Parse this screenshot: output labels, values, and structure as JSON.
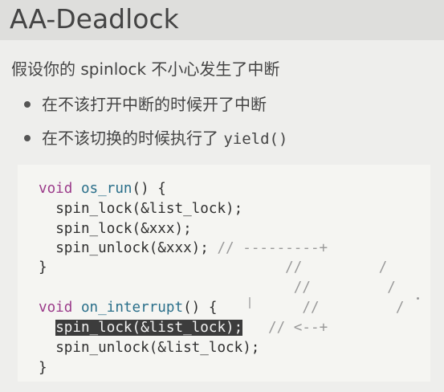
{
  "slide": {
    "title": "AA-Deadlock",
    "subtitle": "假设你的 spinlock 不小心发生了中断",
    "bullets": [
      {
        "text": "在不该打开中断的时候开了中断",
        "mono": ""
      },
      {
        "text": "在不该切换的时候执行了 ",
        "mono": "yield()"
      }
    ]
  },
  "code": {
    "lines": [
      {
        "kw": "void",
        "fn": "os_run",
        "rest": "() {"
      },
      {
        "indent": "  ",
        "text": "spin_lock(&list_lock);"
      },
      {
        "indent": "  ",
        "text": "spin_lock(&xxx);"
      },
      {
        "indent": "  ",
        "text": "spin_unlock(&xxx);",
        "comment": " // ---------+"
      },
      {
        "text": "}",
        "comment": "                            //         /"
      },
      {
        "comment": "                              //         /"
      },
      {
        "kw": "void",
        "fn": "on_interrupt",
        "rest": "() {",
        "comment": "          //         /"
      },
      {
        "indent": "  ",
        "highlight": "spin_lock(&list_lock);",
        "comment": "   // <--+"
      },
      {
        "indent": "  ",
        "text": "spin_unlock(&list_lock);"
      },
      {
        "text": "}"
      }
    ]
  }
}
